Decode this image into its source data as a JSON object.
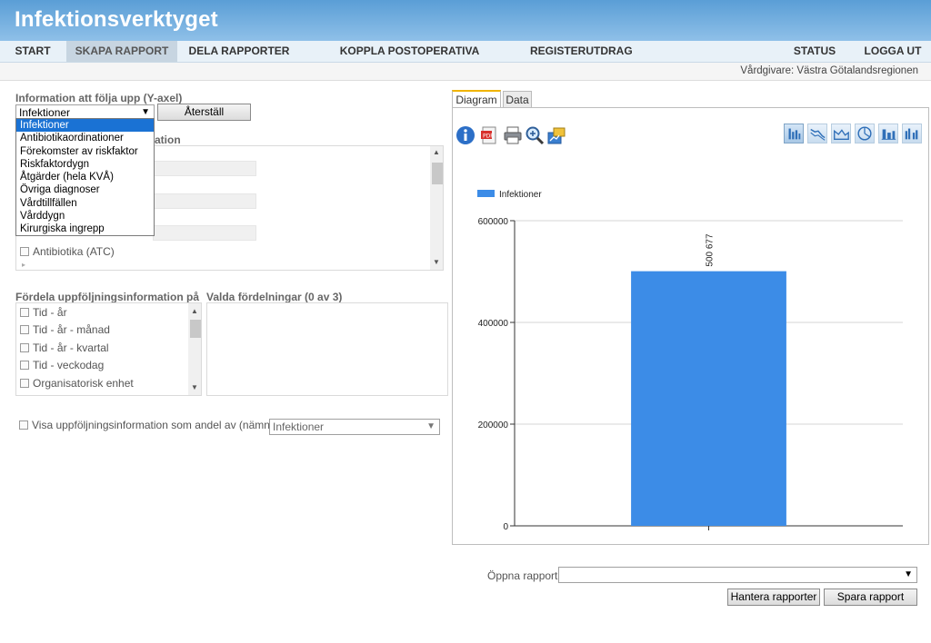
{
  "app": {
    "title": "Infektionsverktyget"
  },
  "nav": {
    "left": [
      "START",
      "SKAPA RAPPORT",
      "DELA RAPPORTER",
      "KOPPLA POSTOPERATIVA INFEKTIONER",
      "REGISTERUTDRAG"
    ],
    "active": "SKAPA RAPPORT",
    "status": "STATUS",
    "logout": "LOGGA UT"
  },
  "subbar": {
    "caregiver": "Vårdgivare: Västra Götalandsregionen"
  },
  "yaxis": {
    "label": "Information att följa upp (Y-axel)",
    "selected": "Infektioner",
    "reset_button": "Återställ",
    "options": [
      "Infektioner",
      "Antibiotikaordinationer",
      "Förekomster av riskfaktor",
      "Riskfaktordygn",
      "Åtgärder (hela KVÅ)",
      "Övriga diagnoser",
      "Vårdtillfällen",
      "Vårddygn",
      "Kirurgiska ingrepp"
    ]
  },
  "filter": {
    "label_fragment": "ation",
    "antibiotics_item": "Antibiotika (ATC)"
  },
  "distribute": {
    "label": "Fördela uppföljningsinformation på",
    "items": [
      "Tid - år",
      "Tid - år - månad",
      "Tid - år - kvartal",
      "Tid - veckodag",
      "Organisatorisk enhet"
    ]
  },
  "selected_distributions": {
    "label": "Valda fördelningar (0 av 3)"
  },
  "share": {
    "label": "Visa uppföljningsinformation som andel av (nämnare)",
    "selected": "Infektioner"
  },
  "tabs": [
    "Diagram",
    "Data"
  ],
  "active_tab": "Diagram",
  "toolbar": {
    "tools": [
      "info-icon",
      "export-pdf-icon",
      "print-icon",
      "zoom-icon",
      "settings-icon"
    ],
    "chart_types": [
      "bar-chart-type-icon",
      "line-chart-type-icon",
      "area-chart-type-icon",
      "pie-chart-type-icon",
      "stacked-bar-type-icon",
      "grouped-bar-type-icon"
    ]
  },
  "chart_data": {
    "type": "bar",
    "categories": [
      ""
    ],
    "series": [
      {
        "name": "Infektioner",
        "values": [
          500677
        ]
      }
    ],
    "data_labels": [
      "500 677"
    ],
    "ylim": [
      0,
      600000
    ],
    "yticks": [
      "0",
      "200000",
      "400000",
      "600000"
    ],
    "legend": "top-left",
    "grid": true,
    "colors": {
      "bar": "#3c8ce7"
    }
  },
  "report": {
    "open_label": "Öppna rapport",
    "open_value": "",
    "manage_button": "Hantera rapporter",
    "save_button": "Spara rapport"
  }
}
